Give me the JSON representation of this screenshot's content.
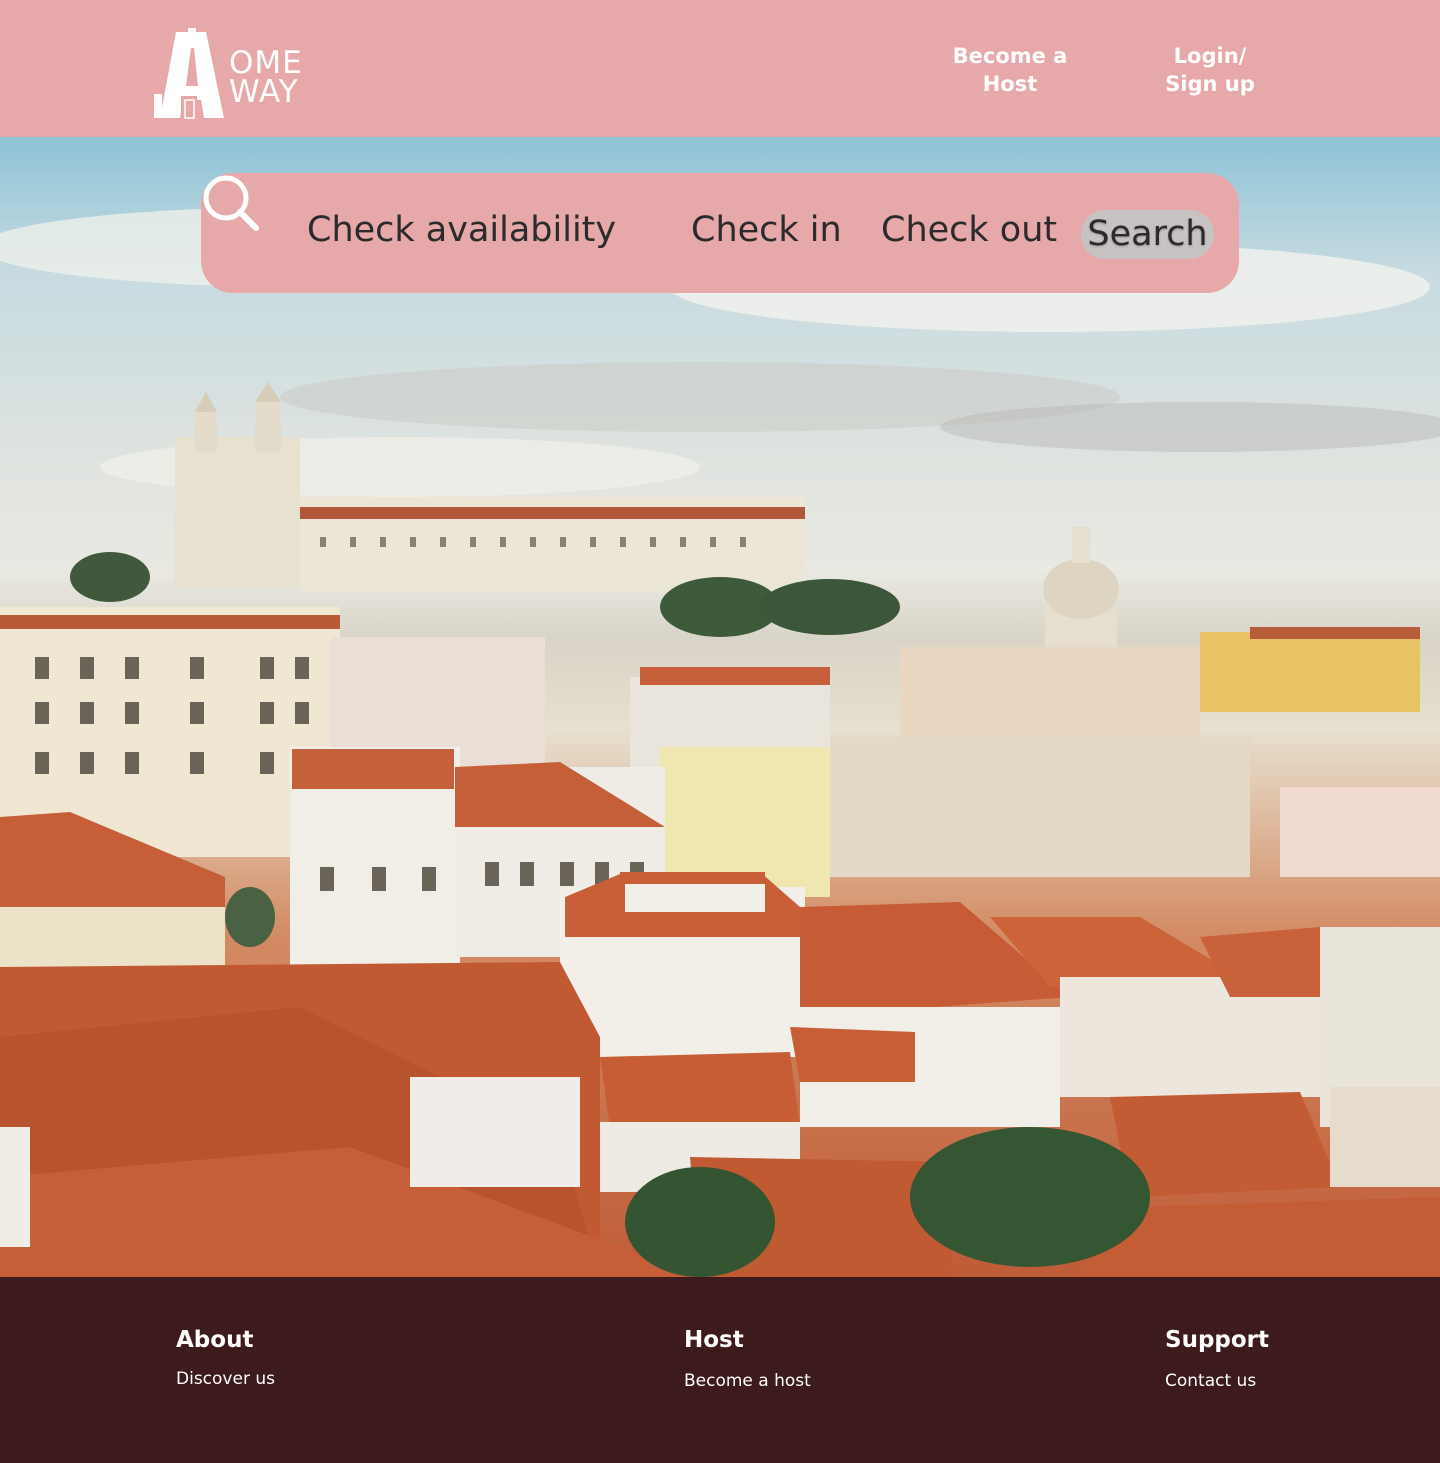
{
  "brand": {
    "logo_letter_a": "A",
    "logo_line1": "OME",
    "logo_line2": "WAY"
  },
  "nav": {
    "become_host": "Become a\nHost",
    "login": "Login/\nSign up"
  },
  "search": {
    "check_availability": "Check availability",
    "check_in": "Check in",
    "check_out": "Check out",
    "search_button": "Search",
    "icon": "search-icon"
  },
  "footer": {
    "about": {
      "heading": "About",
      "link": "Discover us"
    },
    "host": {
      "heading": "Host",
      "link": "Become a host"
    },
    "support": {
      "heading": "Support",
      "link": "Contact us"
    }
  },
  "colors": {
    "header_bg": "#e6a8a8",
    "footer_bg": "#3d1a1b",
    "search_button_bg": "#c8c3c3",
    "text_dark": "#2b2b2b",
    "text_light": "#ffffff"
  }
}
